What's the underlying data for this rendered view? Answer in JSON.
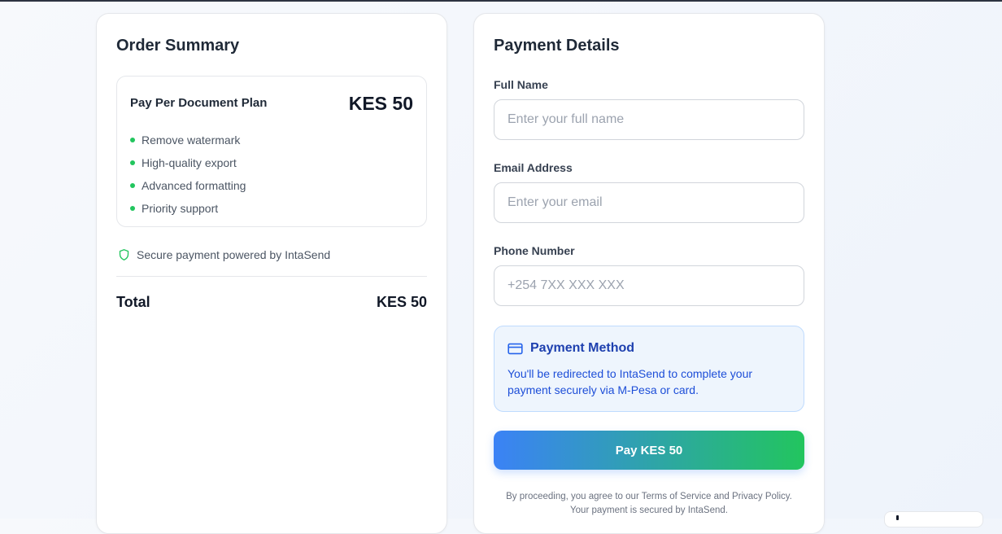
{
  "order_summary": {
    "title": "Order Summary",
    "plan": {
      "name": "Pay Per Document Plan",
      "price": "KES 50",
      "features": [
        "Remove watermark",
        "High-quality export",
        "Advanced formatting",
        "Priority support"
      ]
    },
    "secure_note": "Secure payment powered by IntaSend",
    "total_label": "Total",
    "total_value": "KES 50"
  },
  "payment": {
    "title": "Payment Details",
    "fields": {
      "name": {
        "label": "Full Name",
        "placeholder": "Enter your full name",
        "value": ""
      },
      "email": {
        "label": "Email Address",
        "placeholder": "Enter your email",
        "value": ""
      },
      "phone": {
        "label": "Phone Number",
        "placeholder": "+254 7XX XXX XXX",
        "value": ""
      }
    },
    "method": {
      "title": "Payment Method",
      "description": "You'll be redirected to IntaSend to complete your payment securely via M-Pesa or card."
    },
    "pay_button": "Pay KES 50",
    "legal_line1": "By proceeding, you agree to our Terms of Service and Privacy Policy.",
    "legal_line2": "Your payment is secured by IntaSend."
  },
  "icons": {
    "feature_bullet": "check-dot",
    "secure": "shield-icon",
    "method": "credit-card-icon"
  },
  "colors": {
    "accent_blue": "#3b82f6",
    "accent_green": "#22c55e",
    "method_text": "#1d4ed8",
    "method_bg": "#eef5fd"
  }
}
